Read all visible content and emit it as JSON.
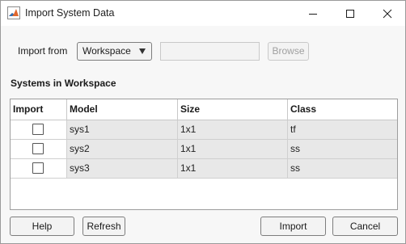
{
  "window": {
    "title": "Import System Data"
  },
  "import_row": {
    "label": "Import from",
    "source_value": "Workspace",
    "path_value": "",
    "browse_label": "Browse"
  },
  "section": {
    "title": "Systems in Workspace"
  },
  "table": {
    "headers": [
      "Import",
      "Model",
      "Size",
      "Class"
    ],
    "rows": [
      {
        "model": "sys1",
        "size": "1x1",
        "class": "tf",
        "checked": false
      },
      {
        "model": "sys2",
        "size": "1x1",
        "class": "ss",
        "checked": false
      },
      {
        "model": "sys3",
        "size": "1x1",
        "class": "ss",
        "checked": false
      }
    ]
  },
  "buttons": {
    "help": "Help",
    "refresh": "Refresh",
    "import": "Import",
    "cancel": "Cancel"
  },
  "icons": {
    "app": "matlab-icon",
    "minimize": "minimize-icon",
    "maximize": "maximize-icon",
    "close": "close-icon",
    "dropdown": "chevron-down-icon"
  }
}
